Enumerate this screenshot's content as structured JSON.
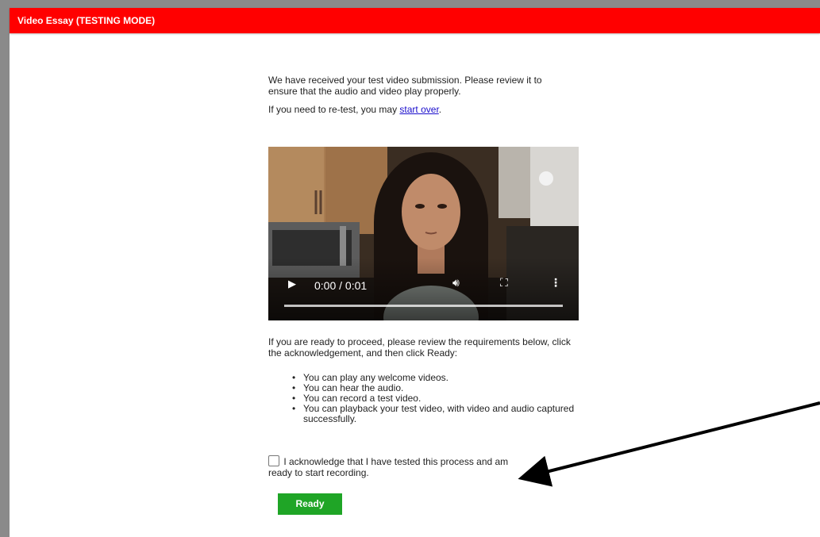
{
  "window": {
    "title": "Video Essay (TESTING MODE)"
  },
  "intro": {
    "text": "We have received your test video submission. Please review it to ensure that the audio and video play properly.",
    "retest_prefix": "If you need to re-test, you may ",
    "retest_link": "start over",
    "retest_suffix": "."
  },
  "video": {
    "time": "0:00 / 0:01",
    "play_icon": "play-icon",
    "volume_icon": "volume-icon",
    "fullscreen_icon": "fullscreen-icon",
    "more_icon": "more-vertical-icon"
  },
  "requirements": {
    "intro": "If you are ready to proceed, please review the requirements below, click the acknowledgement, and then click Ready:",
    "items": [
      "You can play any welcome videos.",
      "You can hear the audio.",
      "You can record a test video.",
      "You can playback your test video, with video and audio captured successfully."
    ]
  },
  "acknowledgement": {
    "label": "I acknowledge that I have tested this process and am ready to start recording.",
    "checked": false
  },
  "actions": {
    "ready_label": "Ready"
  },
  "colors": {
    "header": "#ff0000",
    "ready": "#1fa526",
    "link": "#1a0dcc"
  }
}
